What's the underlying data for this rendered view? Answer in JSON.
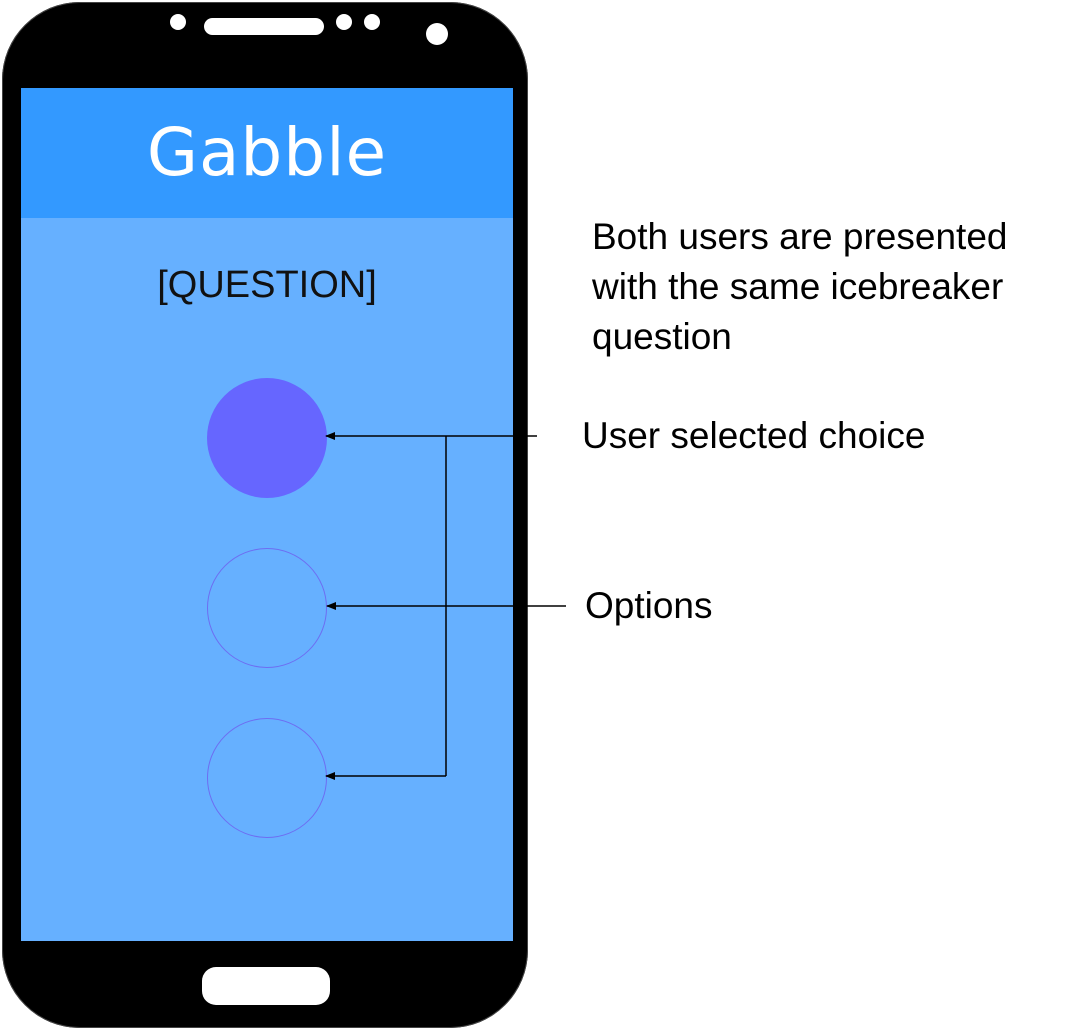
{
  "app": {
    "title": "Gabble"
  },
  "screen": {
    "question": "[QUESTION]",
    "options": [
      {
        "state": "selected"
      },
      {
        "state": "unselected"
      },
      {
        "state": "unselected"
      }
    ]
  },
  "annotations": {
    "presented_line1": "Both users are presented",
    "presented_line2": "with the same icebreaker",
    "presented_line3": "question",
    "selected_choice": "User selected choice",
    "options": "Options"
  },
  "colors": {
    "app_bar": "#3399ff",
    "screen_background": "#66b0ff",
    "selected_option": "#6666ff",
    "unselected_option_border": "#6d6df2",
    "phone_body": "#000000"
  }
}
